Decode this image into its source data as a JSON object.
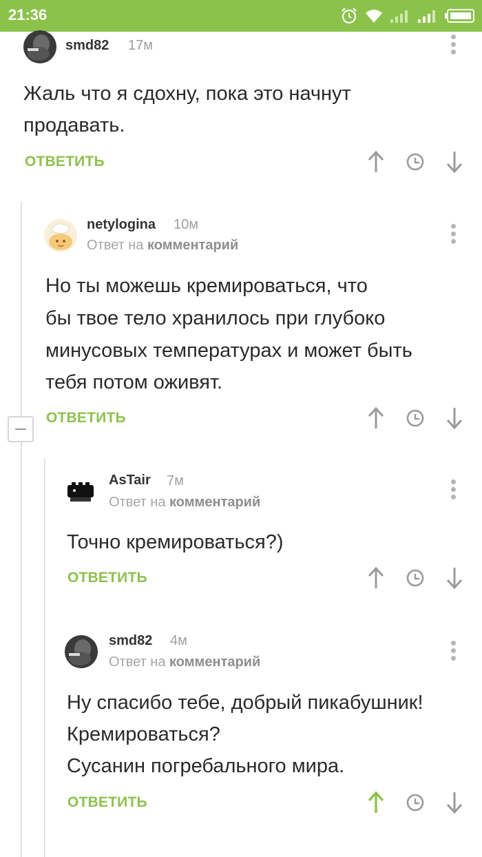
{
  "status_bar": {
    "time": "21:36"
  },
  "comments": [
    {
      "username": "smd82",
      "time": "17м",
      "reply_prefix": "",
      "reply_target": "",
      "body": [
        "Жаль что я сдохну, пока это начнут",
        "продавать."
      ],
      "reply_label": "ОТВЕТИТЬ",
      "upvoted": false
    },
    {
      "username": "netylogina",
      "time": "10м",
      "reply_prefix": "Ответ на",
      "reply_target": "комментарий",
      "body": [
        "Но ты можешь кремироваться, что",
        "бы твое тело хранилось при глубоко",
        "минусовых температурах и может быть",
        "тебя потом оживят."
      ],
      "reply_label": "ОТВЕТИТЬ",
      "upvoted": false
    },
    {
      "username": "AsTair",
      "time": "7м",
      "reply_prefix": "Ответ на",
      "reply_target": "комментарий",
      "body": [
        "Точно кремироваться?)"
      ],
      "reply_label": "ОТВЕТИТЬ",
      "upvoted": false
    },
    {
      "username": "smd82",
      "time": "4м",
      "reply_prefix": "Ответ на",
      "reply_target": "комментарий",
      "body": [
        "Ну спасибо тебе, добрый пикабушник!",
        "Кремироваться?",
        "Сусанин погребального мира."
      ],
      "reply_label": "ОТВЕТИТЬ",
      "upvoted": true
    }
  ],
  "colors": {
    "accent": "#8bc34a",
    "upvote_active": "#8bc34a",
    "icon_gray": "#9a9a9a"
  },
  "icons": [
    "alarm-icon",
    "wifi-icon",
    "signal-icon",
    "battery-icon",
    "more-vert-icon",
    "arrow-up-icon",
    "clock-icon",
    "arrow-down-icon"
  ]
}
